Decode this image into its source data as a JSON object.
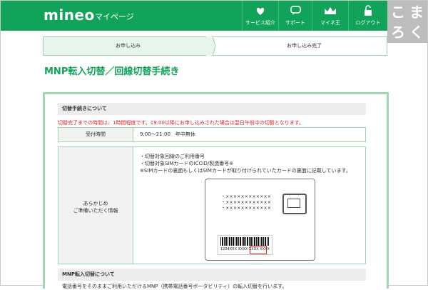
{
  "header": {
    "logo": "mineo",
    "subtitle": "マイページ",
    "nav": [
      {
        "label": "サービス紹介",
        "icon": "heart-leaf-icon"
      },
      {
        "label": "サポート",
        "icon": "chat-bubble-icon"
      },
      {
        "label": "マイネ王",
        "icon": "crown-icon"
      },
      {
        "label": "ログアウト",
        "icon": "lock-icon"
      }
    ],
    "watermark": [
      "こ",
      "ま",
      "ろ",
      "く"
    ]
  },
  "steps": {
    "step1": "お申し込み",
    "step2": "お申し込み完了"
  },
  "page_title": "MNP転入切替／回線切替手続き",
  "section1": {
    "heading": "切替手続きについて",
    "note": "切替完了までの時間は、1時間程度です。19:00以降にお申し込みされた場合は翌日午前中の切替となります。",
    "reception": {
      "label": "受付時間",
      "value": "9:00～21:00　年中無休"
    },
    "prep": {
      "label_line1": "あらかじめ",
      "label_line2": "ご準備いただく情報",
      "item1": "・切替対象回線のご利用番号",
      "item2": "・切替対象SIMカードのICCID/製造番号※",
      "item3": "※SIMカードの裏面もしくはSIMカードが取り付けられていたカードの裏面に記載しています。"
    },
    "card": {
      "dots1": "・××××××××××××",
      "dots2": "・××××××××××××",
      "dots3": "・××××××××××××",
      "number": "1234XXX XXXX XXXX XXXX"
    }
  },
  "section2": {
    "heading": "MNP転入切替について",
    "text": "電話番号をそのままご利用いただけるMNP（携帯電話番号ポータビリティ）の転入切替を行います。"
  },
  "colors": {
    "brand": "#11a35a",
    "border": "#9fd8b1",
    "alert": "#e02020"
  }
}
